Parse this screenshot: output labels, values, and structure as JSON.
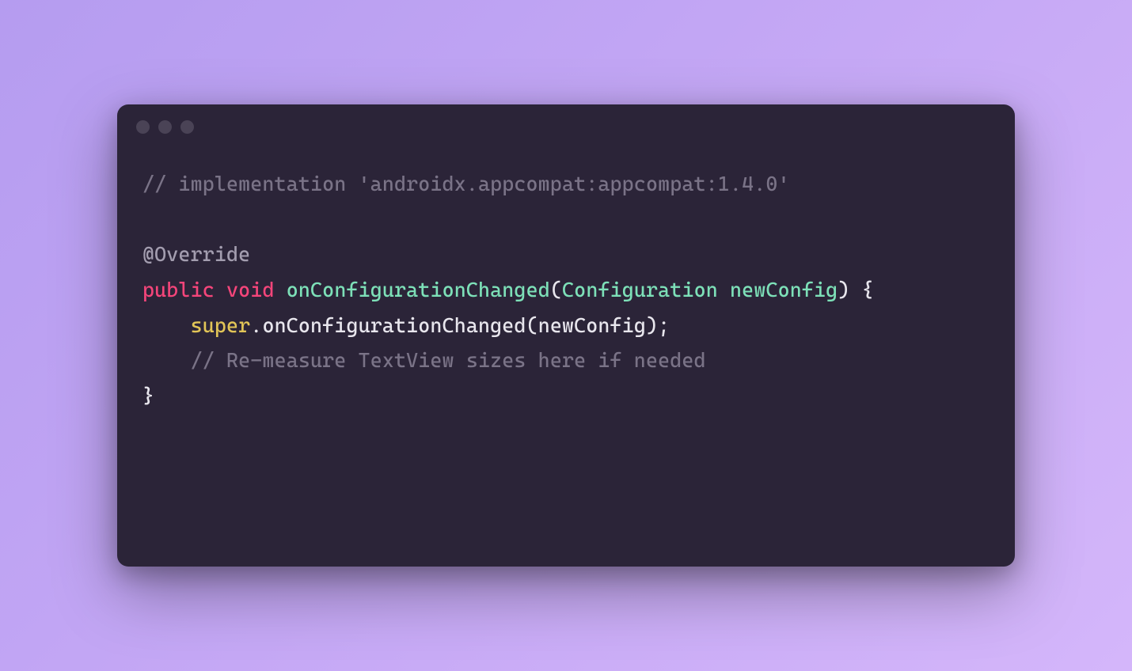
{
  "colors": {
    "editor_bg": "#2b2438",
    "comment": "#7a7387",
    "annotation": "#a39daf",
    "keyword": "#f4457a",
    "method": "#7de0b8",
    "super": "#e2c557",
    "plain": "#e8e6ed"
  },
  "code": {
    "line1_comment": "// implementation 'androidx.appcompat:appcompat:1.4.0'",
    "line3_annotation": "@Override",
    "line4_kw_public": "public",
    "line4_kw_void": "void",
    "line4_method": "onConfigurationChanged",
    "line4_open_paren": "(",
    "line4_type": "Configuration",
    "line4_param": "newConfig",
    "line4_close_paren": ")",
    "line4_brace_open": " {",
    "line5_indent": "    ",
    "line5_super": "super",
    "line5_dot": ".",
    "line5_call": "onConfigurationChanged(newConfig);",
    "line6_indent": "    ",
    "line6_comment": "// Re-measure TextView sizes here if needed",
    "line7_brace_close": "}"
  }
}
